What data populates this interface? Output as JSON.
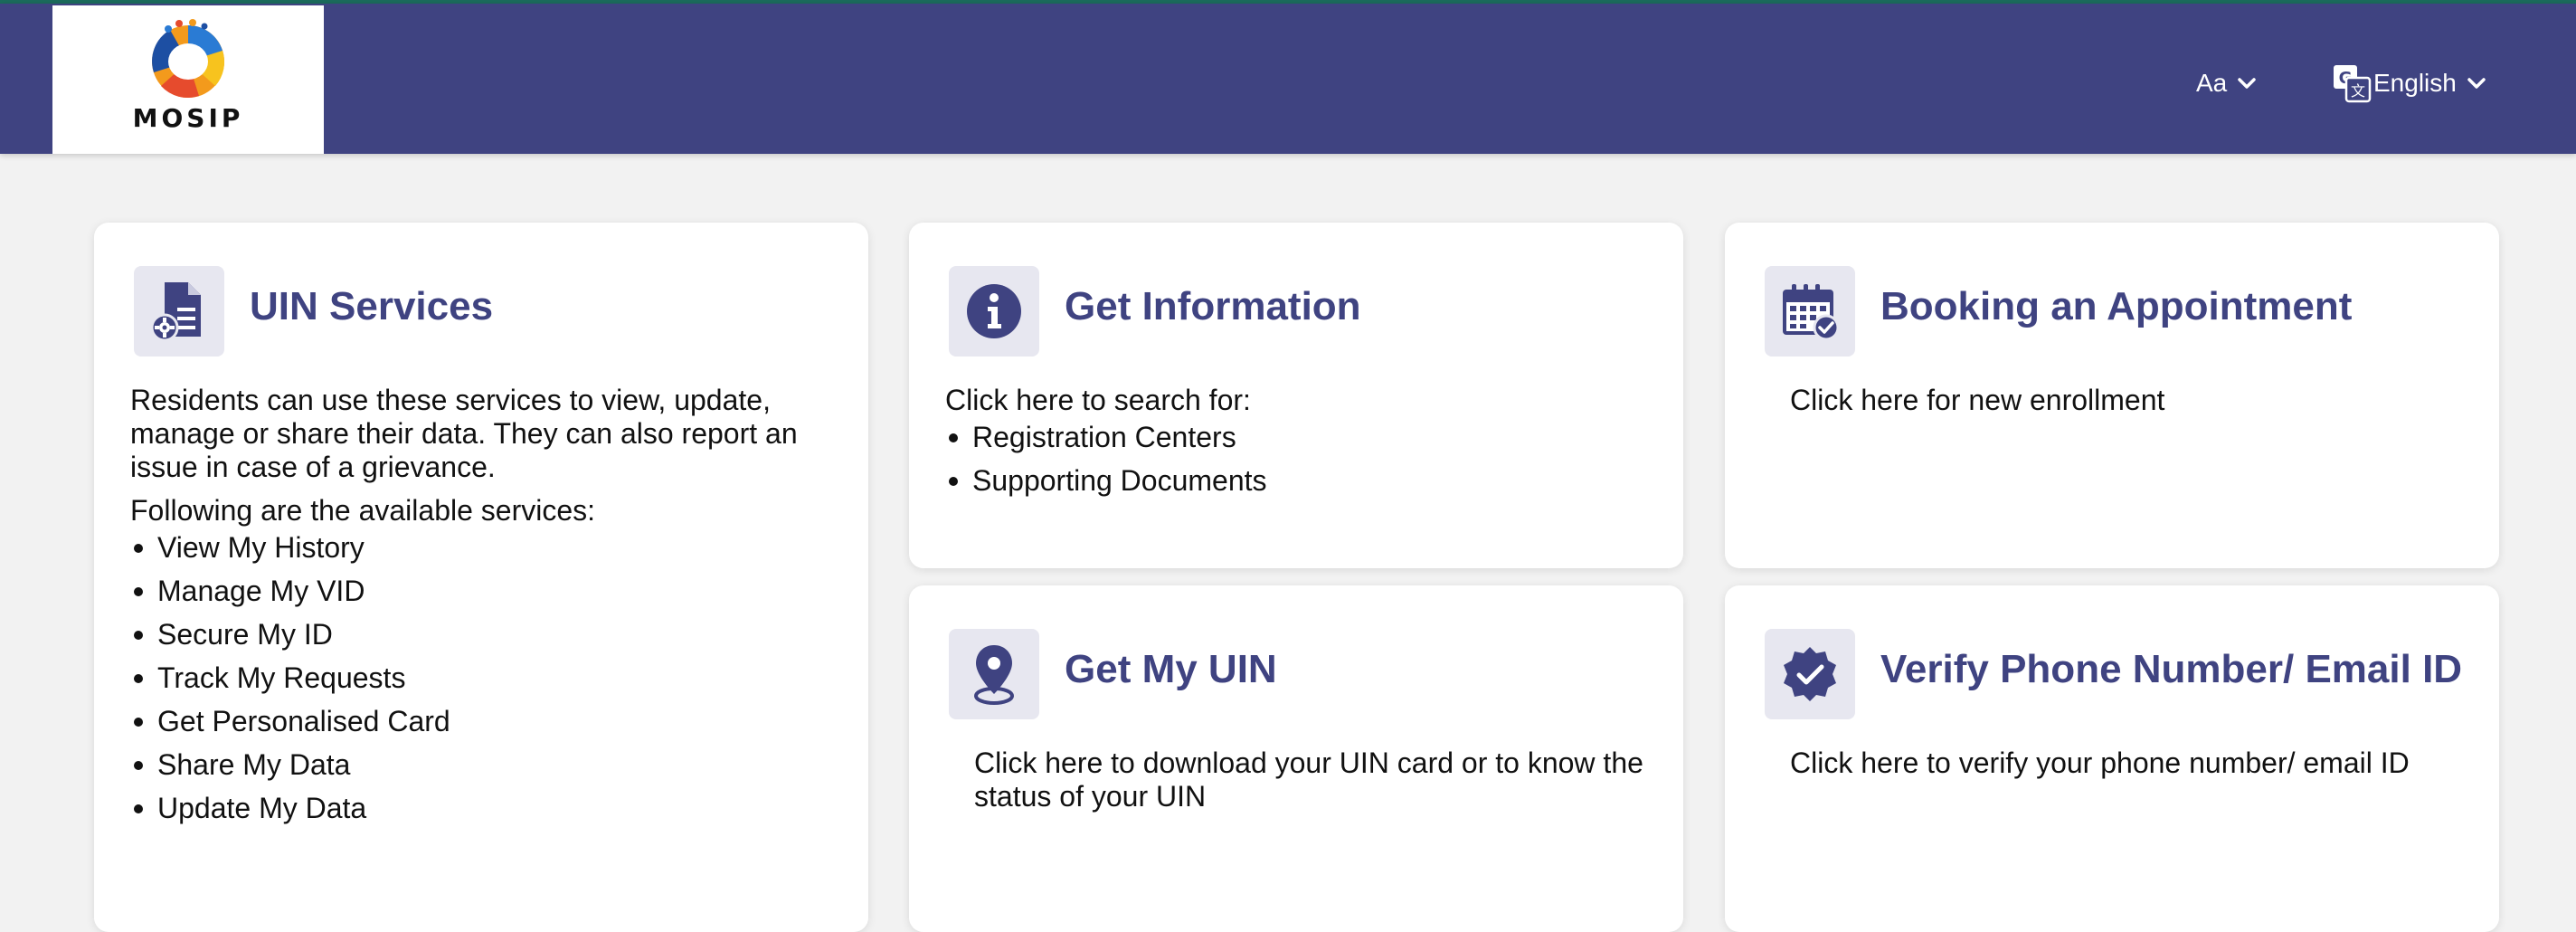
{
  "header": {
    "logo_text": "MOSIP",
    "font_size_label": "Aa",
    "language_label": "English",
    "colors": {
      "header_bg": "#3f4381",
      "accent": "#3f4381",
      "icon_bg": "#e7e7f0"
    }
  },
  "cards": {
    "uin_services": {
      "icon": "document-gear-icon",
      "title": "UIN Services",
      "description": "Residents can use these services to view, update, manage or share their data. They can also report an issue in case of a grievance.",
      "list_intro": "Following are the available services:",
      "items": [
        "View My History",
        "Manage My VID",
        "Secure My ID",
        "Track My Requests",
        "Get Personalised Card",
        "Share My Data",
        "Update My Data"
      ]
    },
    "get_information": {
      "icon": "info-icon",
      "title": "Get Information",
      "description": "Click here to search for:",
      "items": [
        "Registration Centers",
        "Supporting Documents"
      ]
    },
    "booking": {
      "icon": "calendar-check-icon",
      "title": "Booking an Appointment",
      "description": "Click here for new enrollment"
    },
    "get_my_uin": {
      "icon": "location-pin-icon",
      "title": "Get My UIN",
      "description": "Click here to download your UIN card or to know the status of your UIN"
    },
    "verify": {
      "icon": "verified-badge-icon",
      "title": "Verify Phone Number/ Email ID",
      "description": "Click here to verify your phone number/ email ID"
    }
  }
}
